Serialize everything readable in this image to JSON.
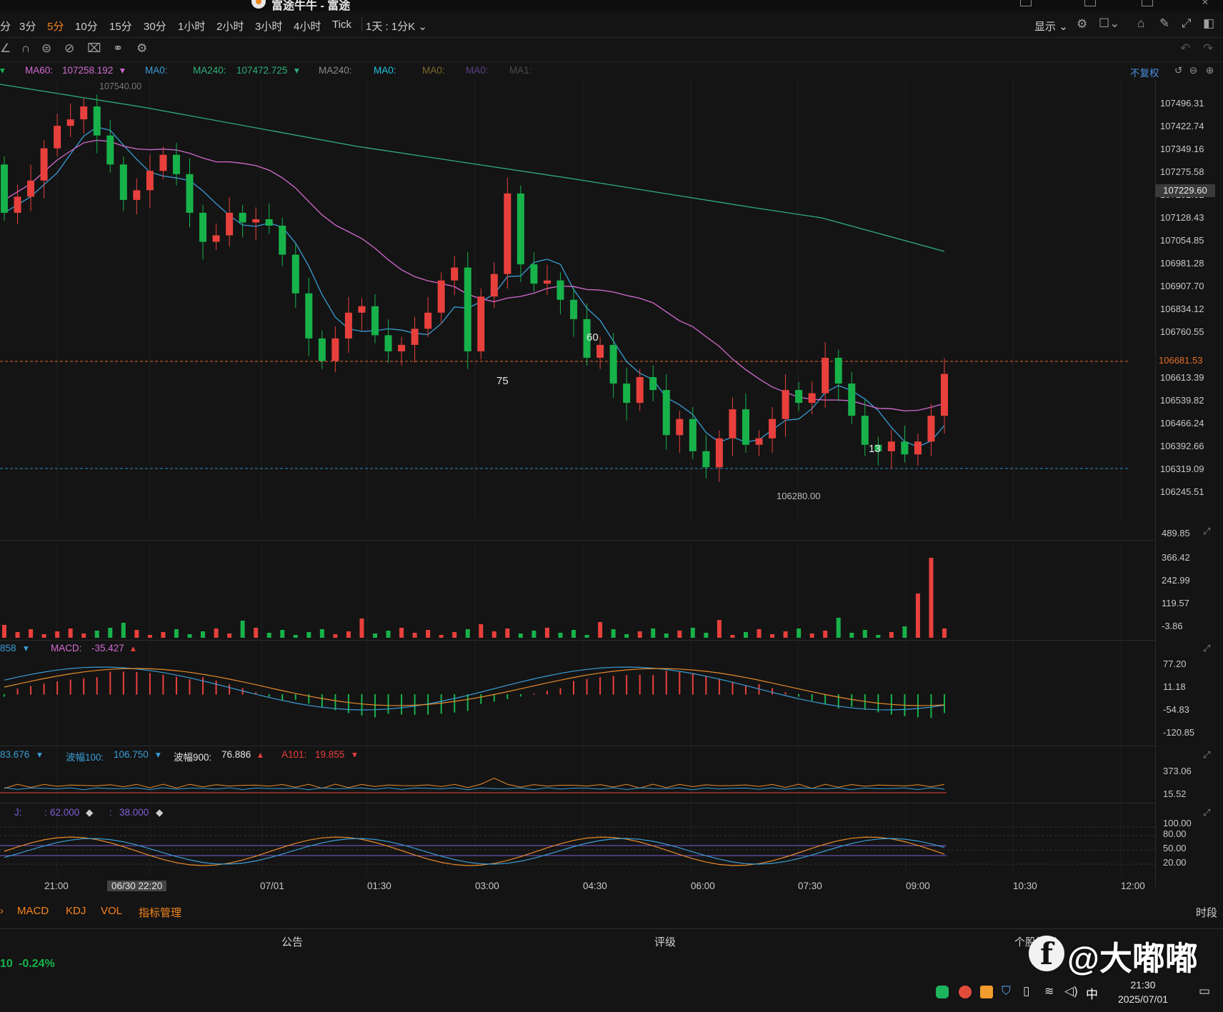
{
  "window": {
    "title": "富途牛牛 - 富途"
  },
  "timeframes": [
    {
      "label": "分",
      "active": false
    },
    {
      "label": "3分",
      "active": false
    },
    {
      "label": "5分",
      "active": true
    },
    {
      "label": "10分",
      "active": false
    },
    {
      "label": "15分",
      "active": false
    },
    {
      "label": "30分",
      "active": false
    },
    {
      "label": "1小时",
      "active": false
    },
    {
      "label": "2小时",
      "active": false
    },
    {
      "label": "3小时",
      "active": false
    },
    {
      "label": "4小时",
      "active": false
    },
    {
      "label": "Tick",
      "active": false
    }
  ],
  "toolbar": {
    "range_select": "1天 : 1分K",
    "display_label": "显示"
  },
  "legend": {
    "ma60_label": "MA60:",
    "ma60_value": "107258.192",
    "ma0_label": "MA0:",
    "ma240_label": "MA240:",
    "ma240_value": "107472.725",
    "ma240b_label": "MA240:",
    "ma0b_label": "MA0:",
    "ma0c_label": "MA0:",
    "ma0d_label": "MA0:",
    "ma1_label": "MA1:",
    "adjust_label": "不复权"
  },
  "price_axis": [
    "107496.31",
    "107422.74",
    "107349.16",
    "107275.58",
    "107202.01",
    "107128.43",
    "107054.85",
    "106981.28",
    "106907.70",
    "106834.12",
    "106760.55",
    "106613.39",
    "106539.82",
    "106466.24",
    "106392.66",
    "106319.09",
    "106245.51"
  ],
  "current_price": "107229.60",
  "marked_price": "106681.53",
  "high_label": "107540.00",
  "low_label": "106280.00",
  "annotations": [
    "75",
    "60",
    "13"
  ],
  "volume_axis": [
    "489.85",
    "366.42",
    "242.99",
    "119.57",
    "-3.86"
  ],
  "macd": {
    "left_value": "858",
    "label": "MACD:",
    "value": "-35.427",
    "axis": [
      "77.20",
      "11.18",
      "-54.83",
      "-120.85"
    ]
  },
  "wave": {
    "v1": "83.676",
    "l2": "波幅100:",
    "v2": "106.750",
    "l3": "波幅900:",
    "v3": "76.886",
    "l4": "A101:",
    "v4": "19.855",
    "axis": [
      "373.06",
      "15.52"
    ]
  },
  "kdj": {
    "j_label": "J:",
    "v1": "62.000",
    "v2": "38.000",
    "axis": [
      "100.00",
      "80.00",
      "50.00",
      "20.00"
    ]
  },
  "time_axis": [
    "21:00",
    "06/30 22:20",
    "07/01",
    "01:30",
    "03:00",
    "04:30",
    "06:00",
    "07:30",
    "09:00",
    "10:30",
    "12:00"
  ],
  "indicator_tabs": [
    "MACD",
    "KDJ",
    "VOL",
    "指标管理"
  ],
  "right_tab": "时段",
  "bottom_tabs": [
    "公告",
    "评级",
    "个股笔记"
  ],
  "ticker": {
    "value": "10",
    "change": "-0.24%"
  },
  "clock": {
    "time": "21:30",
    "date": "2025/07/01",
    "ime": "中"
  },
  "watermark": "@大嘟嘟",
  "colors": {
    "up": "#e8403c",
    "down": "#17b24a",
    "ma_fast": "#3a9dd6",
    "ma60": "#d36bd2",
    "ma240": "#2fae7a",
    "accent": "#f7841c"
  },
  "chart_data": {
    "type": "candlestick",
    "price_range": [
      106245.51,
      107540.0
    ],
    "closes": [
      107150,
      107200,
      107250,
      107350,
      107420,
      107440,
      107480,
      107390,
      107300,
      107190,
      107220,
      107280,
      107330,
      107270,
      107150,
      107060,
      107080,
      107150,
      107120,
      107130,
      107110,
      107020,
      106900,
      106760,
      106690,
      106760,
      106840,
      106860,
      106770,
      106720,
      106740,
      106790,
      106840,
      106940,
      106980,
      106720,
      106890,
      106960,
      107210,
      106990,
      106930,
      106940,
      106880,
      106820,
      106700,
      106740,
      106620,
      106560,
      106640,
      106600,
      106460,
      106510,
      106410,
      106360,
      106450,
      106540,
      106430,
      106450,
      106510,
      106600,
      106560,
      106590,
      106700,
      106620,
      106520,
      106430,
      106410,
      106440,
      106400,
      106440,
      106520,
      106650
    ]
  }
}
